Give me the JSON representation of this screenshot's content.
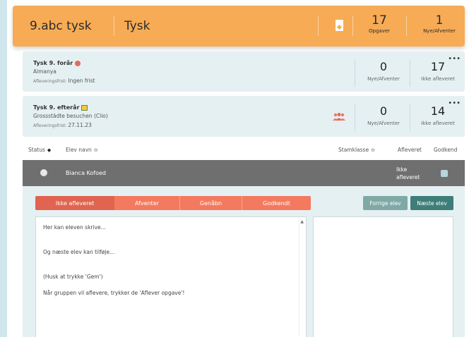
{
  "header": {
    "class_name": "9.abc tysk",
    "subject": "Tysk",
    "assignments_count": "17",
    "assignments_label": "Opgaver",
    "new_pending_count": "1",
    "new_pending_label": "Nye/Afventer"
  },
  "cards": [
    {
      "title": "Tysk 9. forår",
      "subtitle": "Almanya",
      "due_label": "Afleveringsfrist:",
      "due_value": "Ingen frist",
      "stat1_num": "0",
      "stat1_label": "Nye/Afventer",
      "stat2_num": "17",
      "stat2_label": "Ikke afleveret",
      "more": "•••"
    },
    {
      "title": "Tysk 9. efterår",
      "subtitle": "Grossstädte besuchen (Clio)",
      "due_label": "Afleveringsfrist:",
      "due_value": "27.11.23",
      "stat1_num": "0",
      "stat1_label": "Nye/Afventer",
      "stat2_num": "14",
      "stat2_label": "Ikke afleveret",
      "more": "•••"
    }
  ],
  "columns": {
    "status": "Status",
    "student_name": "Elev navn",
    "home_class": "Stamklasse",
    "submitted": "Afleveret",
    "approved": "Godkend"
  },
  "student": {
    "name": "Bianca Kofoed",
    "status_line1": "Ikke",
    "status_line2": "afleveret"
  },
  "status_tabs": [
    "Ikke afleveret",
    "Afventer",
    "Genåbn",
    "Godkendt"
  ],
  "nav": {
    "prev": "Forrige elev",
    "next": "Næste elev"
  },
  "editor_lines": [
    "Her kan eleven skrive...",
    "Og næste elev kan tilføje...",
    "(Husk at trykke 'Gem')",
    "Når gruppen vil aflevere, trykker de 'Aflever opgave'!"
  ],
  "colors": {
    "header": "#f7ab55",
    "card_bg": "#e5f0f2",
    "tab_active": "#e06450",
    "tab": "#f37a5f",
    "btn_prev": "#7fa9a6",
    "btn_next": "#3f7d79",
    "student_row": "#6f6f6f"
  },
  "icons": {
    "bookmark": "bookmark-icon",
    "group": "group-icon",
    "sort": "sort-icon",
    "filter": "filter-icon"
  }
}
